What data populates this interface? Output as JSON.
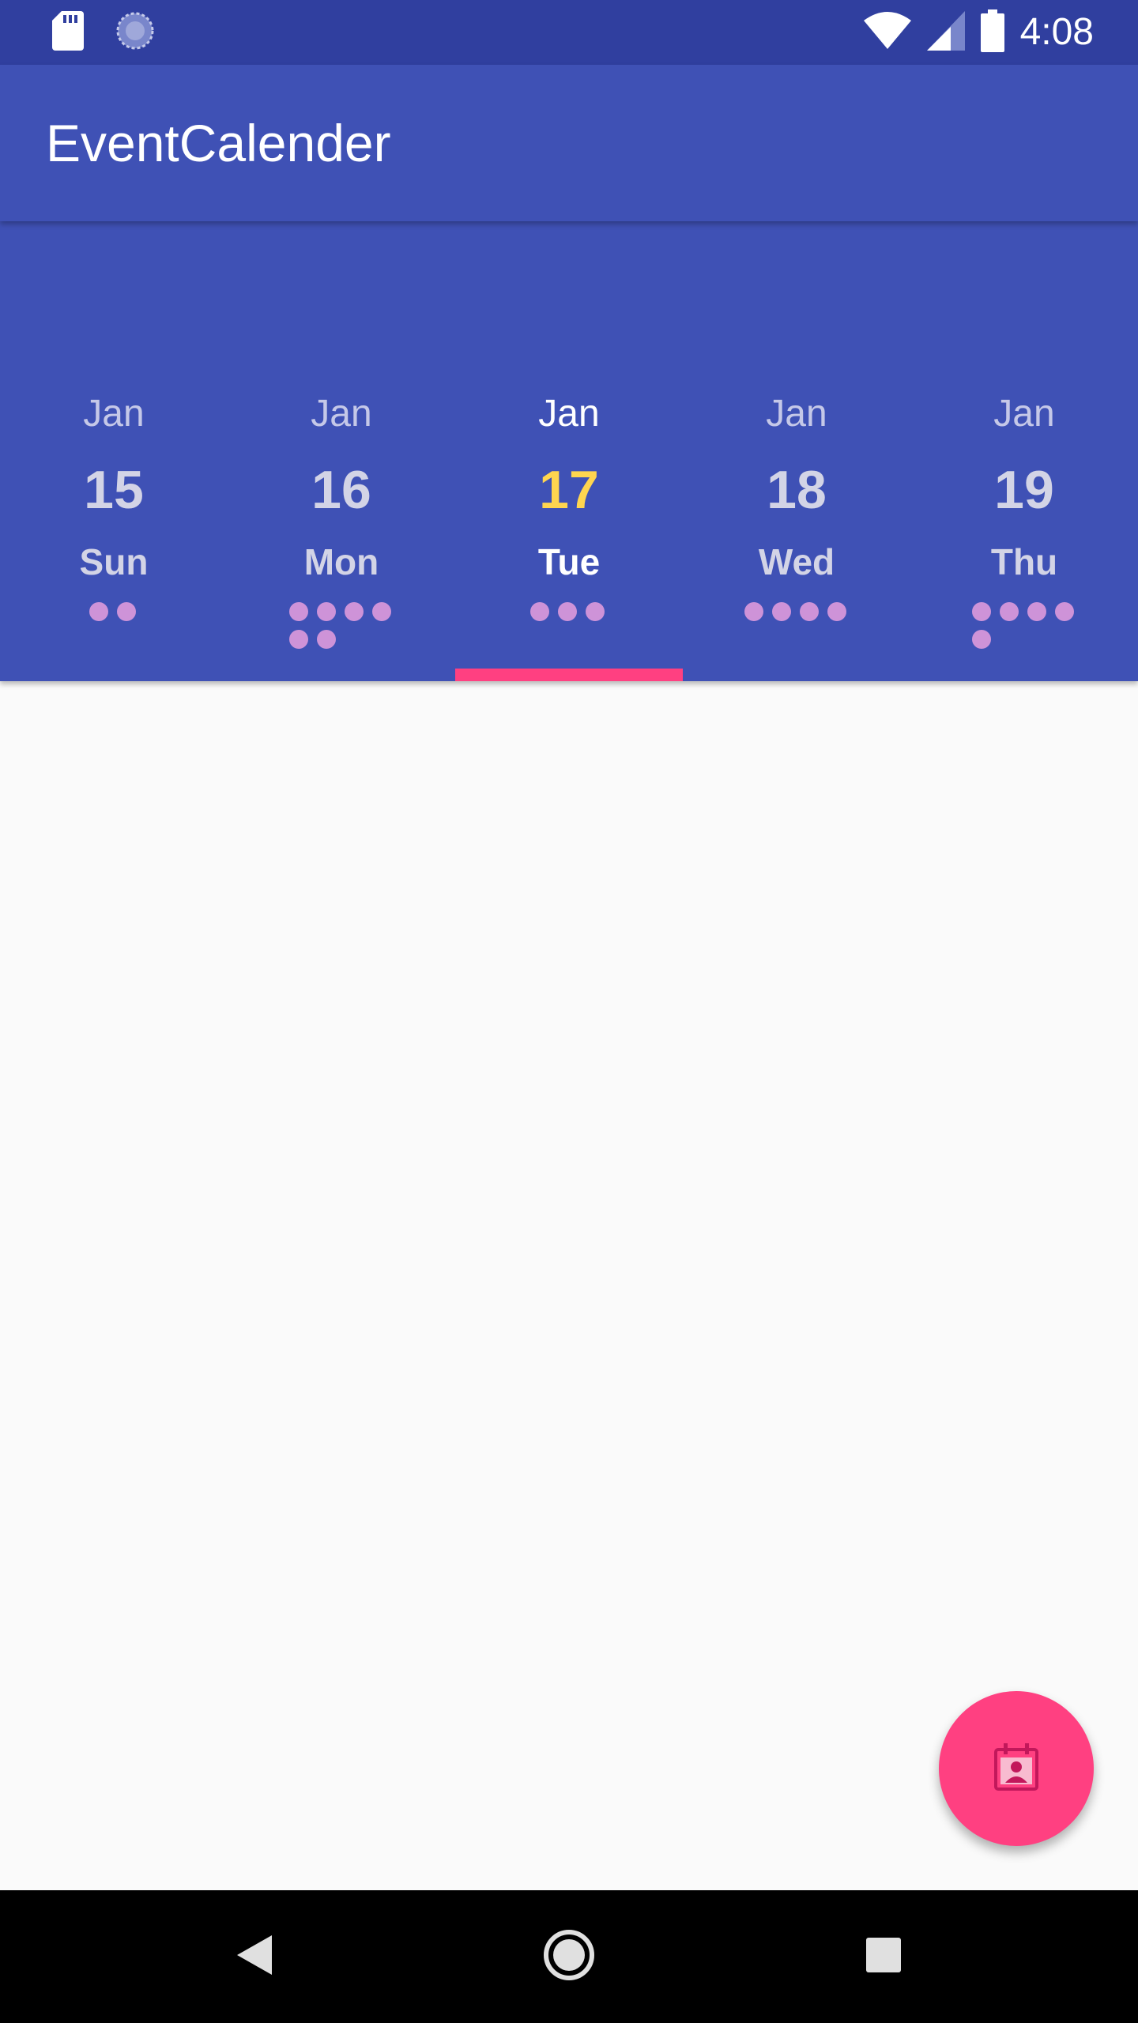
{
  "status_bar": {
    "time": "4:08",
    "icons": [
      "sd-card-icon",
      "sync-icon",
      "wifi-icon",
      "cell-signal-icon",
      "battery-icon"
    ]
  },
  "app_bar": {
    "title": "EventCalender"
  },
  "date_tabs": [
    {
      "month": "Jan",
      "day": "15",
      "weekday": "Sun",
      "event_count": 2,
      "selected": false
    },
    {
      "month": "Jan",
      "day": "16",
      "weekday": "Mon",
      "event_count": 6,
      "selected": false
    },
    {
      "month": "Jan",
      "day": "17",
      "weekday": "Tue",
      "event_count": 3,
      "selected": true
    },
    {
      "month": "Jan",
      "day": "18",
      "weekday": "Wed",
      "event_count": 4,
      "selected": false
    },
    {
      "month": "Jan",
      "day": "19",
      "weekday": "Thu",
      "event_count": 5,
      "selected": false
    }
  ],
  "fab": {
    "icon": "calendar-contact-icon"
  },
  "nav_bar": {
    "icons": [
      "back-icon",
      "home-icon",
      "recents-icon"
    ]
  },
  "colors": {
    "primary": "#3F51B5",
    "primary_dark": "#303F9F",
    "accent": "#FF4081",
    "selected_day": "#FFD54F",
    "event_dot": "#CE93D8",
    "background": "#FAFAFA"
  }
}
